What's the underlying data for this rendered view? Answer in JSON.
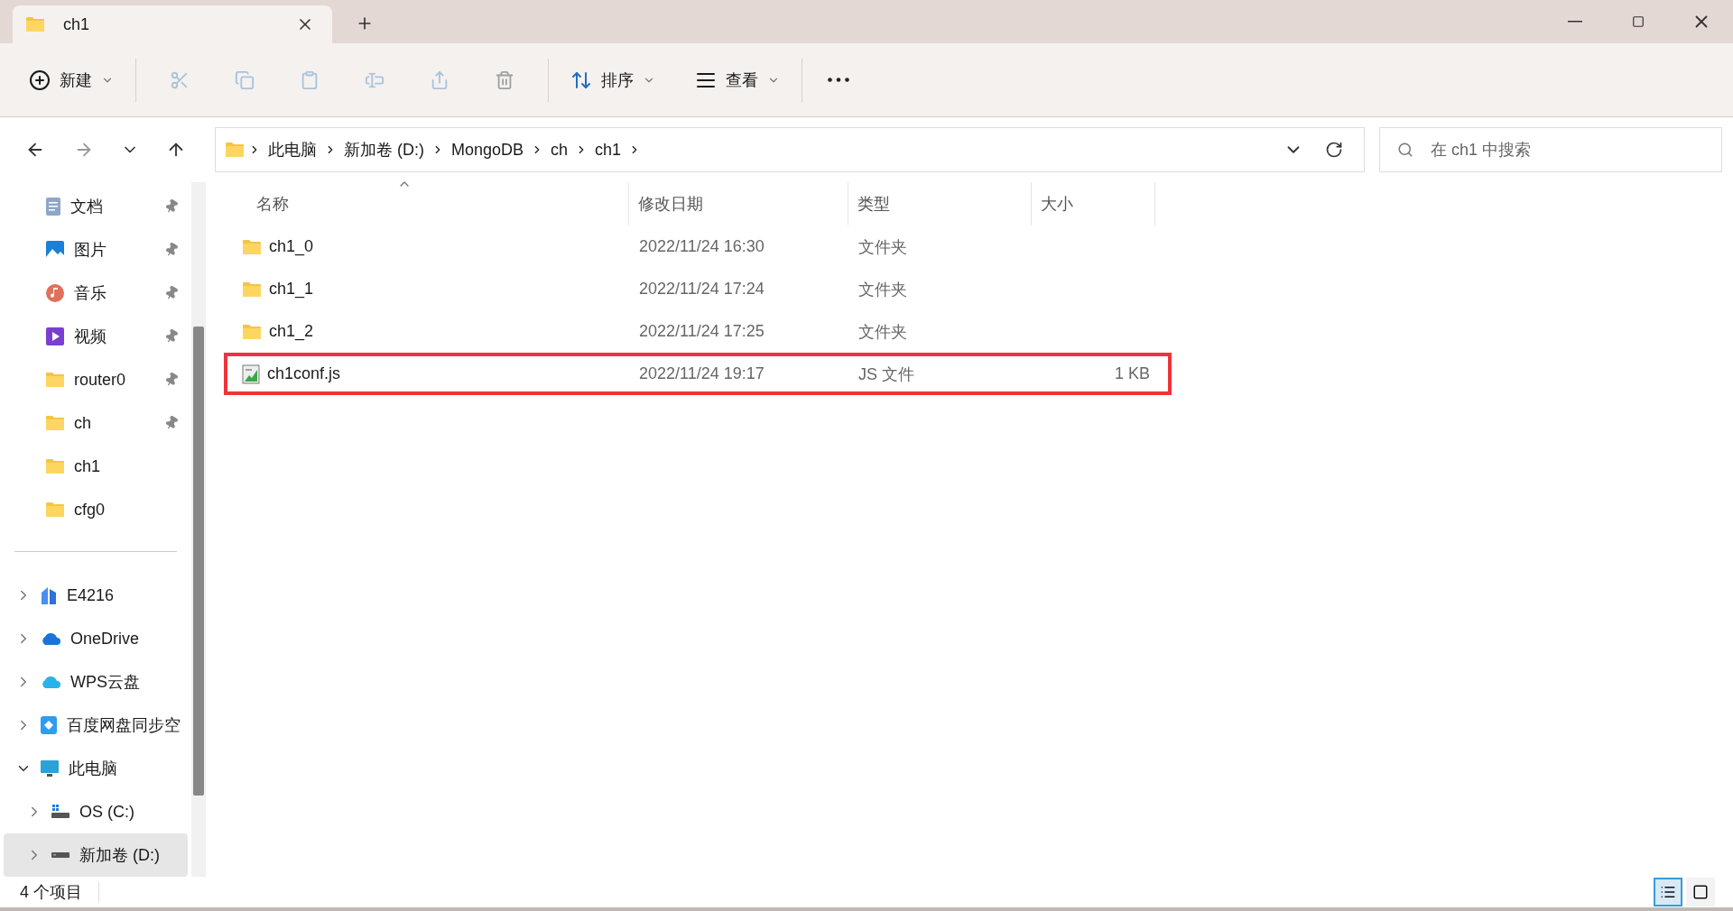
{
  "tab": {
    "title": "ch1"
  },
  "toolbar": {
    "new": {
      "label": "新建"
    },
    "actions": [
      {
        "kind": "cut",
        "disabled": true
      },
      {
        "kind": "copy",
        "disabled": true
      },
      {
        "kind": "paste",
        "disabled": true
      },
      {
        "kind": "rename",
        "disabled": true
      },
      {
        "kind": "share",
        "disabled": true
      },
      {
        "kind": "delete",
        "disabled": true
      }
    ],
    "sort": {
      "label": "排序"
    },
    "view": {
      "label": "查看"
    }
  },
  "address": {
    "crumbs": [
      "此电脑",
      "新加卷 (D:)",
      "MongoDB",
      "ch",
      "ch1"
    ]
  },
  "search": {
    "placeholder": "在 ch1 中搜索"
  },
  "sidebar": {
    "quick_access": [
      {
        "label": "文档",
        "kind": "documents",
        "pinned": true,
        "selected": false
      },
      {
        "label": "图片",
        "kind": "pictures",
        "pinned": true,
        "selected": false
      },
      {
        "label": "音乐",
        "kind": "music",
        "pinned": true,
        "selected": false
      },
      {
        "label": "视频",
        "kind": "videos",
        "pinned": true,
        "selected": false
      },
      {
        "label": "router0",
        "kind": "folder",
        "pinned": true,
        "selected": false
      },
      {
        "label": "ch",
        "kind": "folder",
        "pinned": true,
        "selected": false
      },
      {
        "label": "ch1",
        "kind": "folder",
        "pinned": false,
        "selected": false
      },
      {
        "label": "cfg0",
        "kind": "folder",
        "pinned": false,
        "selected": false
      }
    ],
    "tree": [
      {
        "label": "E4216",
        "kind": "cloud-drive",
        "expanded": false,
        "selected": false
      },
      {
        "label": "OneDrive",
        "kind": "onedrive",
        "expanded": false,
        "selected": false
      },
      {
        "label": "WPS云盘",
        "kind": "wps",
        "expanded": false,
        "selected": false
      },
      {
        "label": "百度网盘同步空",
        "kind": "baidu",
        "expanded": false,
        "selected": false
      },
      {
        "label": "此电脑",
        "kind": "computer",
        "expanded": true,
        "selected": false,
        "children": [
          {
            "label": "OS (C:)",
            "kind": "system-drive",
            "expanded": false,
            "selected": false
          },
          {
            "label": "新加卷 (D:)",
            "kind": "drive",
            "expanded": false,
            "selected": true
          }
        ]
      }
    ]
  },
  "table": {
    "columns": [
      {
        "label": "名称",
        "sorted": true
      },
      {
        "label": "修改日期",
        "sorted": false
      },
      {
        "label": "类型",
        "sorted": false
      },
      {
        "label": "大小",
        "sorted": false
      }
    ],
    "rows": [
      {
        "name": "ch1_0",
        "modified": "2022/11/24 16:30",
        "type": "文件夹",
        "size": "",
        "kind": "folder",
        "highlighted": false
      },
      {
        "name": "ch1_1",
        "modified": "2022/11/24 17:24",
        "type": "文件夹",
        "size": "",
        "kind": "folder",
        "highlighted": false
      },
      {
        "name": "ch1_2",
        "modified": "2022/11/24 17:25",
        "type": "文件夹",
        "size": "",
        "kind": "folder",
        "highlighted": false
      },
      {
        "name": "ch1conf.js",
        "modified": "2022/11/24 19:17",
        "type": "JS 文件",
        "size": "1 KB",
        "kind": "js",
        "highlighted": true
      }
    ]
  },
  "status_bar": {
    "count": "4 个项目",
    "views": [
      {
        "kind": "details",
        "selected": true
      },
      {
        "kind": "tiles",
        "selected": false
      }
    ]
  }
}
